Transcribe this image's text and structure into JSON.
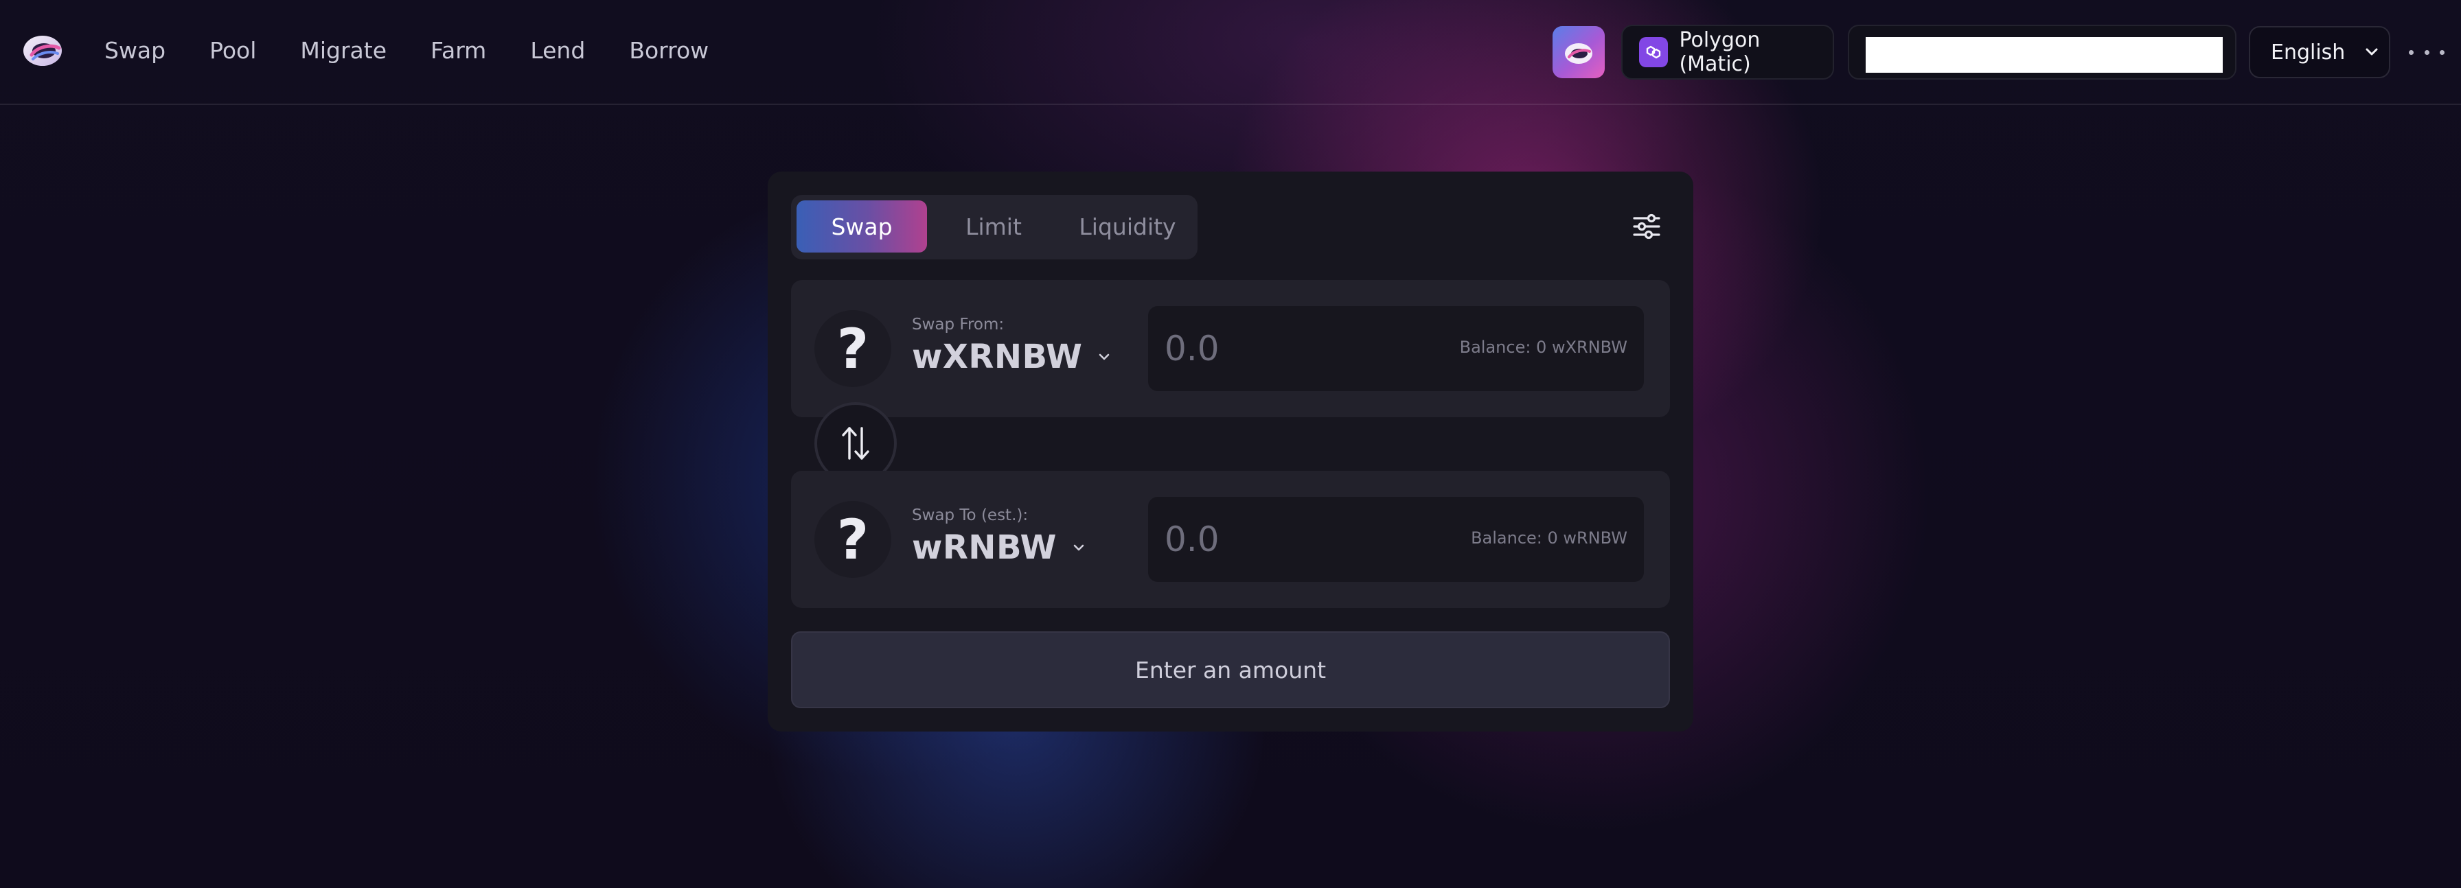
{
  "header": {
    "nav": [
      "Swap",
      "Pool",
      "Migrate",
      "Farm",
      "Lend",
      "Borrow"
    ],
    "network_label": "Polygon (Matic)",
    "language_label": "English",
    "icons": {
      "logo": "rainbow-logo",
      "app": "rainbow-app-icon",
      "network": "polygon-icon",
      "language_chevron": "chevron-down-icon",
      "more": "more-horizontal-icon"
    }
  },
  "swap_card": {
    "tabs": [
      {
        "label": "Swap",
        "active": true
      },
      {
        "label": "Limit",
        "active": false
      },
      {
        "label": "Liquidity",
        "active": false
      }
    ],
    "from": {
      "caption": "Swap From:",
      "token": "wXRNBW",
      "token_icon_glyph": "?",
      "amount_placeholder": "0.0",
      "balance": "Balance: 0 wXRNBW"
    },
    "to": {
      "caption": "Swap To (est.):",
      "token": "wRNBW",
      "token_icon_glyph": "?",
      "amount_placeholder": "0.0",
      "balance": "Balance: 0 wRNBW"
    },
    "action_button": "Enter an amount"
  },
  "colors": {
    "accent_gradient_start": "#3a5fb6",
    "accent_gradient_end": "#b0418f",
    "polygon_purple": "#8247e5"
  }
}
